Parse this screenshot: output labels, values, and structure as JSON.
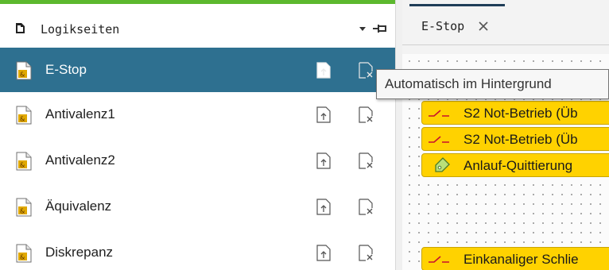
{
  "panel": {
    "title": "Logikseiten",
    "title_icon": "page-icon",
    "accent_color": "#5cb82e",
    "selected_color": "#2e7090"
  },
  "pages": [
    {
      "label": "E-Stop",
      "selected": true
    },
    {
      "label": "Antivalenz1",
      "selected": false
    },
    {
      "label": "Antivalenz2",
      "selected": false
    },
    {
      "label": "Äquivalenz",
      "selected": false
    },
    {
      "label": "Diskrepanz",
      "selected": false
    }
  ],
  "editor": {
    "tab_label": "E-Stop",
    "blocks": [
      {
        "icon": "switch-contact-icon",
        "label": "S2 Not-Betrieb (Üb"
      },
      {
        "icon": "switch-contact-icon",
        "label": "S2 Not-Betrieb (Üb"
      },
      {
        "icon": "tag-icon",
        "label": "Anlauf-Quittierung"
      },
      {
        "icon": "switch-contact-icon",
        "label": "Einkanaliger Schlie"
      }
    ],
    "block_color": "#ffd200"
  },
  "tooltip": {
    "text": "Automatisch im Hintergrund"
  }
}
